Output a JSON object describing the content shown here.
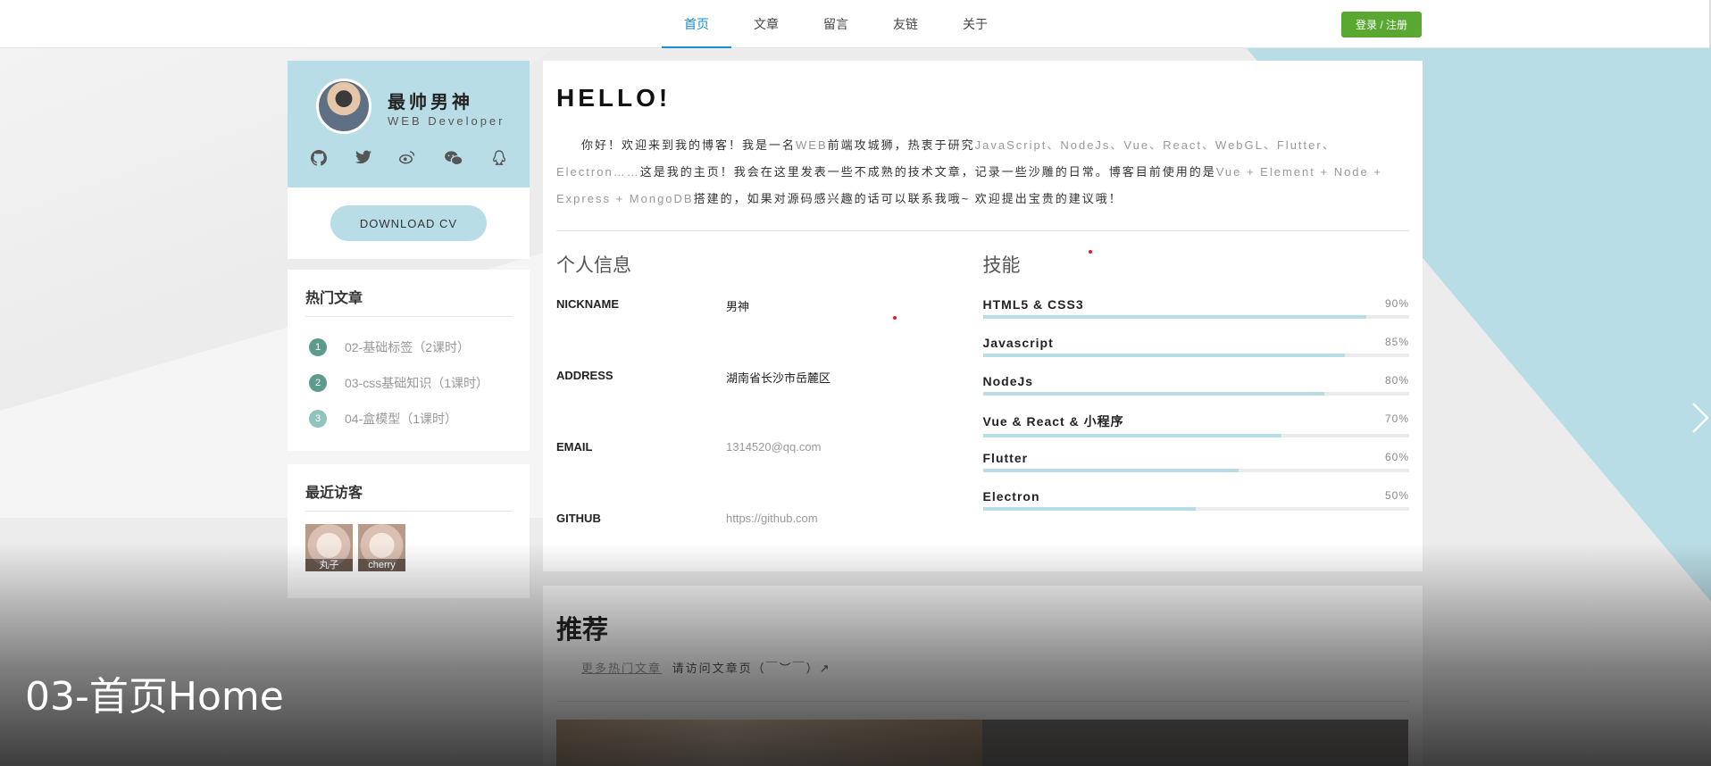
{
  "nav": {
    "items": [
      "首页",
      "文章",
      "留言",
      "友链",
      "关于"
    ],
    "login": "登录 / 注册"
  },
  "profile": {
    "name": "最帅男神",
    "role": "WEB Developer",
    "social_icons": [
      "github-icon",
      "twitter-icon",
      "weibo-icon",
      "wechat-icon",
      "qq-icon"
    ],
    "cv_button": "DOWNLOAD CV"
  },
  "hot": {
    "title": "热门文章",
    "items": [
      {
        "num": "1",
        "text": "02-基础标签（2课时）"
      },
      {
        "num": "2",
        "text": "03-css基础知识（1课时）"
      },
      {
        "num": "3",
        "text": "04-盒模型（1课时）"
      }
    ]
  },
  "visitors": {
    "title": "最近访客",
    "items": [
      {
        "name": "丸子"
      },
      {
        "name": "cherry"
      }
    ]
  },
  "main": {
    "hello": "HELLO!",
    "intro_parts": [
      "你好！欢迎来到我的博客！我是一名",
      "WEB",
      "前端攻城狮，热衷于研究",
      "JavaScript、NodeJs、Vue、React、WebGL、Flutter、Electron……",
      "这是我的主页！我会在这里发表一些不成熟的技术文章，记录一些沙雕的日常。博客目前使用的是",
      "Vue + Element + Node + Express + MongoDB",
      "搭建的，如果对源码感兴趣的话可以联系我哦~ 欢迎提出宝贵的建议哦！"
    ],
    "info_title": "个人信息",
    "info": [
      {
        "key": "NICKNAME",
        "value": "男神"
      },
      {
        "key": "ADDRESS",
        "value": "湖南省长沙市岳麓区"
      },
      {
        "key": "EMAIL",
        "value": "1314520@qq.com"
      },
      {
        "key": "GITHUB",
        "value": "https://github.com"
      }
    ],
    "skills_title": "技能",
    "skills": [
      {
        "name": "HTML5 & CSS3",
        "pct": "90%",
        "level": 0.9
      },
      {
        "name": "Javascript",
        "pct": "85%",
        "level": 0.85
      },
      {
        "name": "NodeJs",
        "pct": "80%",
        "level": 0.8
      },
      {
        "name": "Vue & React & 小程序",
        "pct": "70%",
        "level": 0.7
      },
      {
        "name": "Flutter",
        "pct": "60%",
        "level": 0.6
      },
      {
        "name": "Electron",
        "pct": "50%",
        "level": 0.5
      }
    ]
  },
  "recommend": {
    "title": "推荐",
    "link": "更多热门文章",
    "text": "请访问文章页（￣︶￣）↗"
  },
  "video_title": "03-首页Home",
  "colors": {
    "accent_blue": "#1a8fd6",
    "login_green": "#5aa832",
    "light_blue": "#b9dde6"
  }
}
